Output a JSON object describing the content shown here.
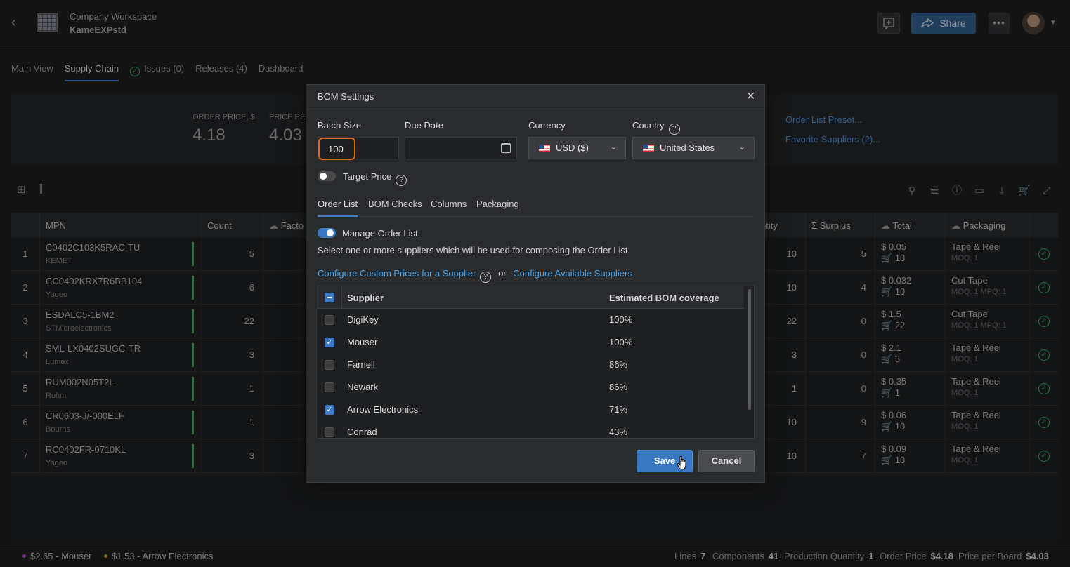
{
  "header": {
    "workspace": "Company Workspace",
    "project": "KameEXPstd",
    "share_label": "Share",
    "more_label": "•••"
  },
  "tabs": [
    {
      "label": "Main View"
    },
    {
      "label": "Supply Chain",
      "active": true
    },
    {
      "label": "Issues (0)"
    },
    {
      "label": "Releases (4)"
    },
    {
      "label": "Dashboard"
    }
  ],
  "summary": {
    "order_price_label": "ORDER PRICE, $",
    "order_price_value": "4.18",
    "price_per_label": "PRICE PER",
    "price_per_value": "4.03",
    "link_preset": "Order List Preset...",
    "link_favorites": "Favorite Suppliers (2)..."
  },
  "grid": {
    "headers": {
      "mpn": "MPN",
      "count": "Count",
      "factor": "Facto",
      "quantity": "ntity",
      "surplus": "Σ Surplus",
      "total": "Total",
      "packaging": "Packaging"
    },
    "rows": [
      {
        "n": "1",
        "mpn": "C0402C103K5RAC-TU",
        "mfr": "KEMET",
        "count": "5",
        "qty": "10",
        "surplus": "5",
        "price": "$ 0.05",
        "buy": "10",
        "pack": "Tape & Reel",
        "moq": "MOQ: 1"
      },
      {
        "n": "2",
        "mpn": "CC0402KRX7R6BB104",
        "mfr": "Yageo",
        "count": "6",
        "qty": "10",
        "surplus": "4",
        "price": "$ 0.032",
        "buy": "10",
        "pack": "Cut Tape",
        "moq": "MOQ: 1   MPQ: 1"
      },
      {
        "n": "3",
        "mpn": "ESDALC5-1BM2",
        "mfr": "STMicroelectronics",
        "count": "22",
        "qty": "22",
        "surplus": "0",
        "price": "$ 1.5",
        "buy": "22",
        "pack": "Cut Tape",
        "moq": "MOQ: 1   MPQ: 1"
      },
      {
        "n": "4",
        "mpn": "SML-LX0402SUGC-TR",
        "mfr": "Lumex",
        "count": "3",
        "qty": "3",
        "surplus": "0",
        "price": "$ 2.1",
        "buy": "3",
        "pack": "Tape & Reel",
        "moq": "MOQ: 1"
      },
      {
        "n": "5",
        "mpn": "RUM002N05T2L",
        "mfr": "Rohm",
        "count": "1",
        "qty": "1",
        "surplus": "0",
        "price": "$ 0.35",
        "buy": "1",
        "pack": "Tape & Reel",
        "moq": "MOQ: 1"
      },
      {
        "n": "6",
        "mpn": "CR0603-J/-000ELF",
        "mfr": "Bourns",
        "count": "1",
        "qty": "10",
        "surplus": "9",
        "price": "$ 0.06",
        "buy": "10",
        "pack": "Tape & Reel",
        "moq": "MOQ: 1"
      },
      {
        "n": "7",
        "mpn": "RC0402FR-0710KL",
        "mfr": "Yageo",
        "count": "3",
        "qty": "10",
        "surplus": "7",
        "price": "$ 0.09",
        "buy": "10",
        "pack": "Tape & Reel",
        "moq": "MOQ: 1"
      }
    ]
  },
  "footer": {
    "supplier1": "$2.65 - Mouser",
    "supplier1_color": "#b04ad0",
    "supplier2": "$1.53 - Arrow Electronics",
    "supplier2_color": "#d0a020",
    "lines_label": "Lines",
    "lines_value": "7",
    "components_label": "Components",
    "components_value": "41",
    "prodqty_label": "Production Quantity",
    "prodqty_value": "1",
    "orderprice_label": "Order Price",
    "orderprice_value": "$4.18",
    "ppb_label": "Price per Board",
    "ppb_value": "$4.03"
  },
  "modal": {
    "title": "BOM Settings",
    "close": "✕",
    "batch_label": "Batch Size",
    "batch_value": "100",
    "due_label": "Due Date",
    "currency_label": "Currency",
    "currency_value": "USD ($)",
    "country_label": "Country",
    "country_value": "United States",
    "target_price_label": "Target Price",
    "tabs": [
      "Order List",
      "BOM Checks",
      "Columns",
      "Packaging"
    ],
    "manage_label": "Manage Order List",
    "description": "Select one or more suppliers which will be used for composing the Order List.",
    "link_custom": "Configure Custom Prices for a Supplier",
    "or_text": "or",
    "link_available": "Configure Available Suppliers",
    "col_supplier": "Supplier",
    "col_coverage": "Estimated BOM coverage",
    "suppliers": [
      {
        "name": "DigiKey",
        "coverage": "100%",
        "checked": false
      },
      {
        "name": "Mouser",
        "coverage": "100%",
        "checked": true
      },
      {
        "name": "Farnell",
        "coverage": "86%",
        "checked": false
      },
      {
        "name": "Newark",
        "coverage": "86%",
        "checked": false
      },
      {
        "name": "Arrow Electronics",
        "coverage": "71%",
        "checked": true
      },
      {
        "name": "Conrad",
        "coverage": "43%",
        "checked": false
      }
    ],
    "save_label": "Save",
    "cancel_label": "Cancel"
  }
}
